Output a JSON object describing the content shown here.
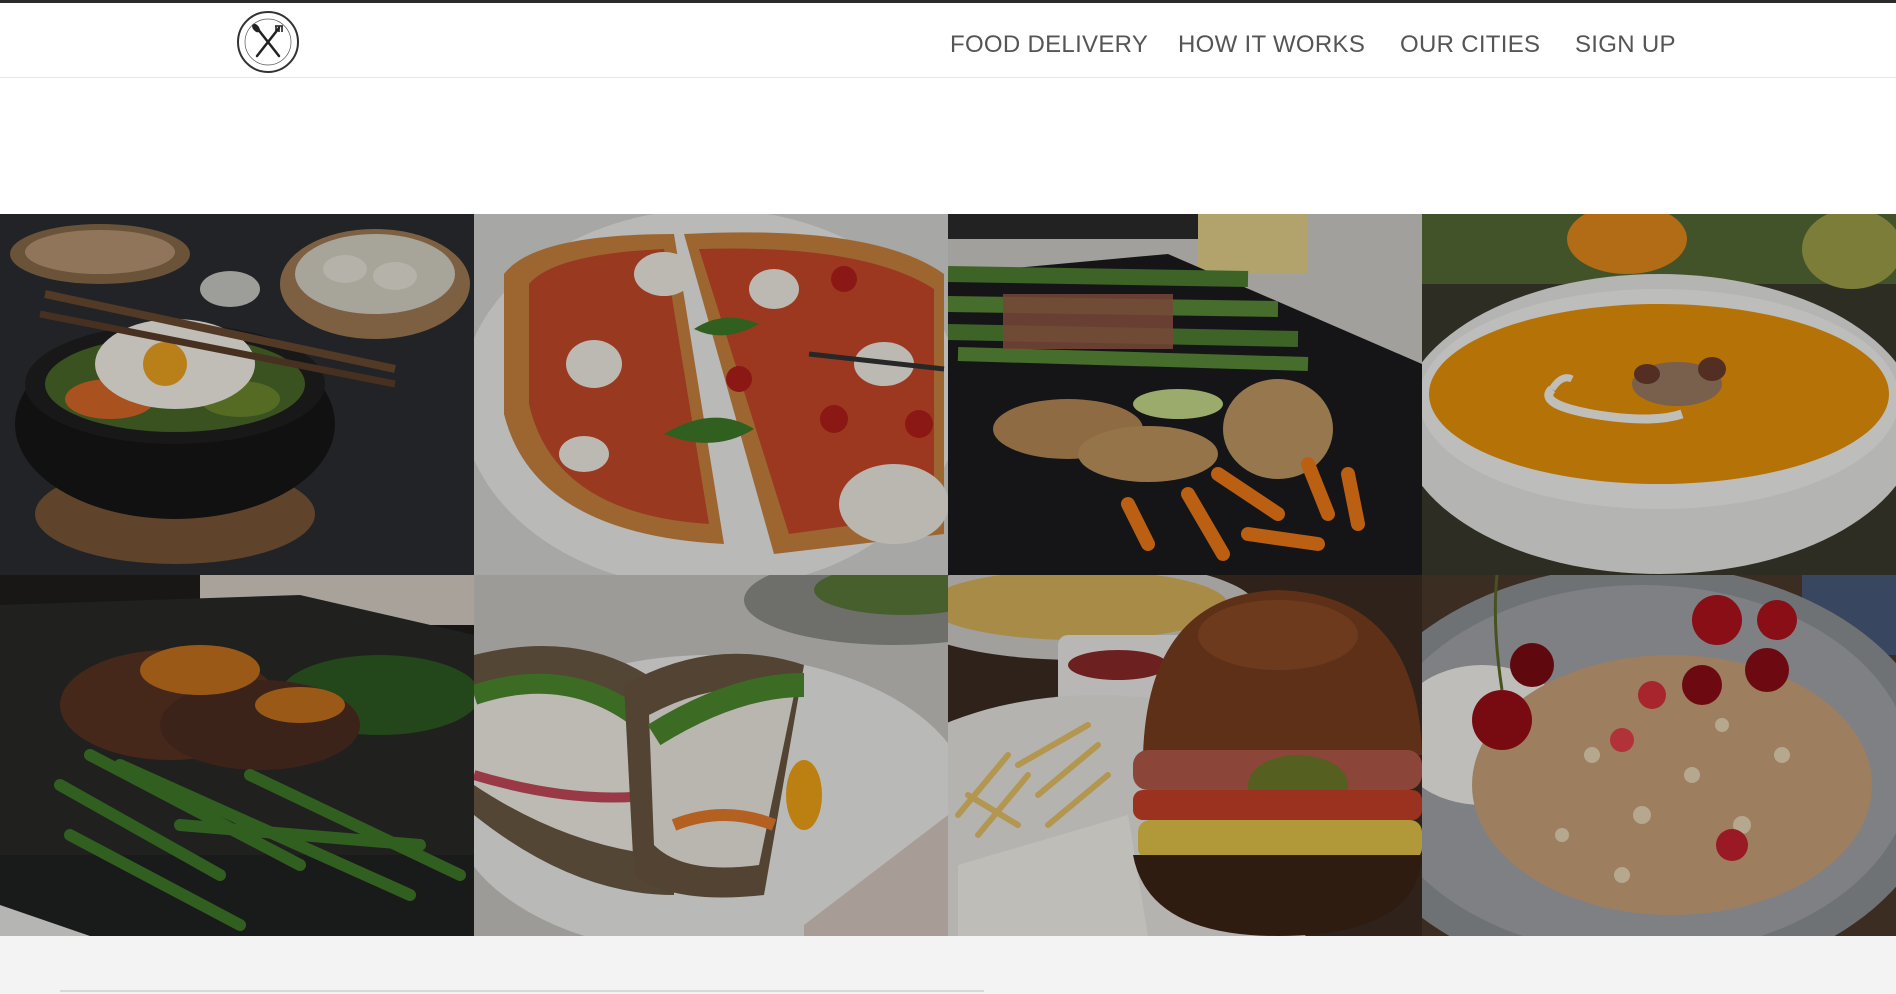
{
  "header": {
    "logo_icon": "fork-knife-icon",
    "nav": [
      {
        "label": "FOOD DELIVERY"
      },
      {
        "label": "HOW IT WORKS"
      },
      {
        "label": "OUR CITIES"
      },
      {
        "label": "SIGN UP"
      }
    ]
  },
  "gallery": {
    "images": [
      {
        "subject": "bibimbap",
        "icon": "bibimbap-image"
      },
      {
        "subject": "pizza",
        "icon": "pizza-image"
      },
      {
        "subject": "asparagus-chicken",
        "icon": "asparagus-chicken-image"
      },
      {
        "subject": "pumpkin-soup",
        "icon": "pumpkin-soup-image"
      },
      {
        "subject": "steak-green-beans",
        "icon": "steak-image"
      },
      {
        "subject": "sandwich",
        "icon": "sandwich-image"
      },
      {
        "subject": "burger-fries",
        "icon": "burger-image"
      },
      {
        "subject": "granola-fruit",
        "icon": "granola-image"
      }
    ]
  },
  "colors": {
    "nav_text": "#555555",
    "header_bg": "#ffffff",
    "footer_bg": "#f3f3f3"
  }
}
